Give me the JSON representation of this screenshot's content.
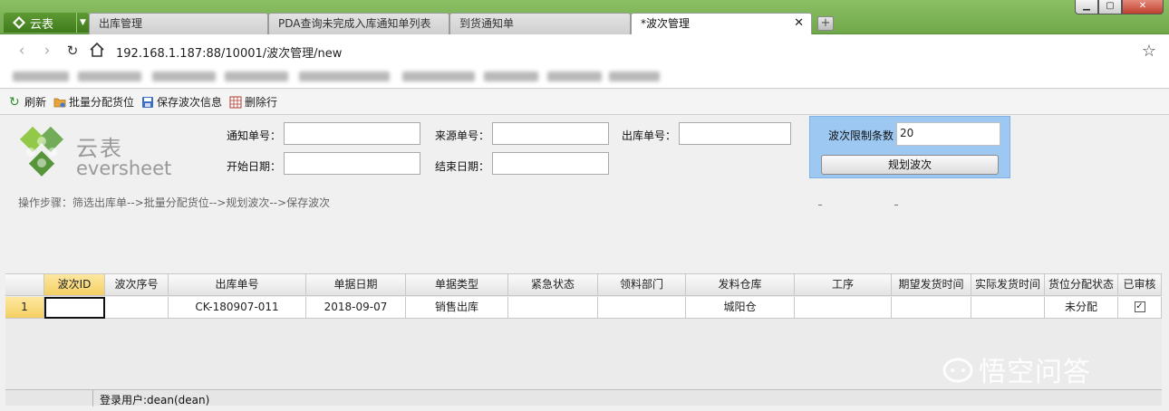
{
  "app": {
    "name": "云表"
  },
  "tabs": [
    {
      "label": "出库管理"
    },
    {
      "label": "PDA查询未完成入库通知单列表"
    },
    {
      "label": "到货通知单"
    },
    {
      "label": "*波次管理",
      "active": true
    }
  ],
  "address": {
    "url": "192.168.1.187:88/10001/波次管理/new"
  },
  "toolbar": {
    "refresh": "刷新",
    "batch_assign": "批量分配货位",
    "save_wave": "保存波次信息",
    "delete_row": "删除行"
  },
  "brand": {
    "cn": "云表",
    "en": "eversheet"
  },
  "form": {
    "notice_no_label": "通知单号：",
    "notice_no_value": "",
    "source_no_label": "来源单号：",
    "source_no_value": "",
    "outbound_no_label": "出库单号：",
    "outbound_no_value": "",
    "start_date_label": "开始日期：",
    "start_date_value": "",
    "end_date_label": "结束日期：",
    "end_date_value": "",
    "limit_label": "波次限制条数",
    "limit_value": "20",
    "plan_button": "规划波次",
    "steps": "操作步骤：筛选出库单-->批量分配货位-->规划波次-->保存波次"
  },
  "grid": {
    "columns": [
      "波次ID",
      "波次序号",
      "出库单号",
      "单据日期",
      "单据类型",
      "紧急状态",
      "领料部门",
      "发料仓库",
      "工序",
      "期望发货时间",
      "实际发货时间",
      "货位分配状态",
      "已审核"
    ],
    "rows": [
      {
        "num": "1",
        "cells": [
          "",
          "",
          "CK-180907-011",
          "2018-09-07",
          "销售出库",
          "",
          "",
          "城阳仓",
          "",
          "",
          "",
          "未分配",
          ""
        ],
        "checked": true
      }
    ]
  },
  "status": {
    "user": "登录用户:dean(dean)"
  },
  "watermark": {
    "text": "悟空问答"
  },
  "colors": {
    "titlebar": "#7db356",
    "limit_box": "#9cc8f2",
    "row_header": "#f5cf63"
  }
}
